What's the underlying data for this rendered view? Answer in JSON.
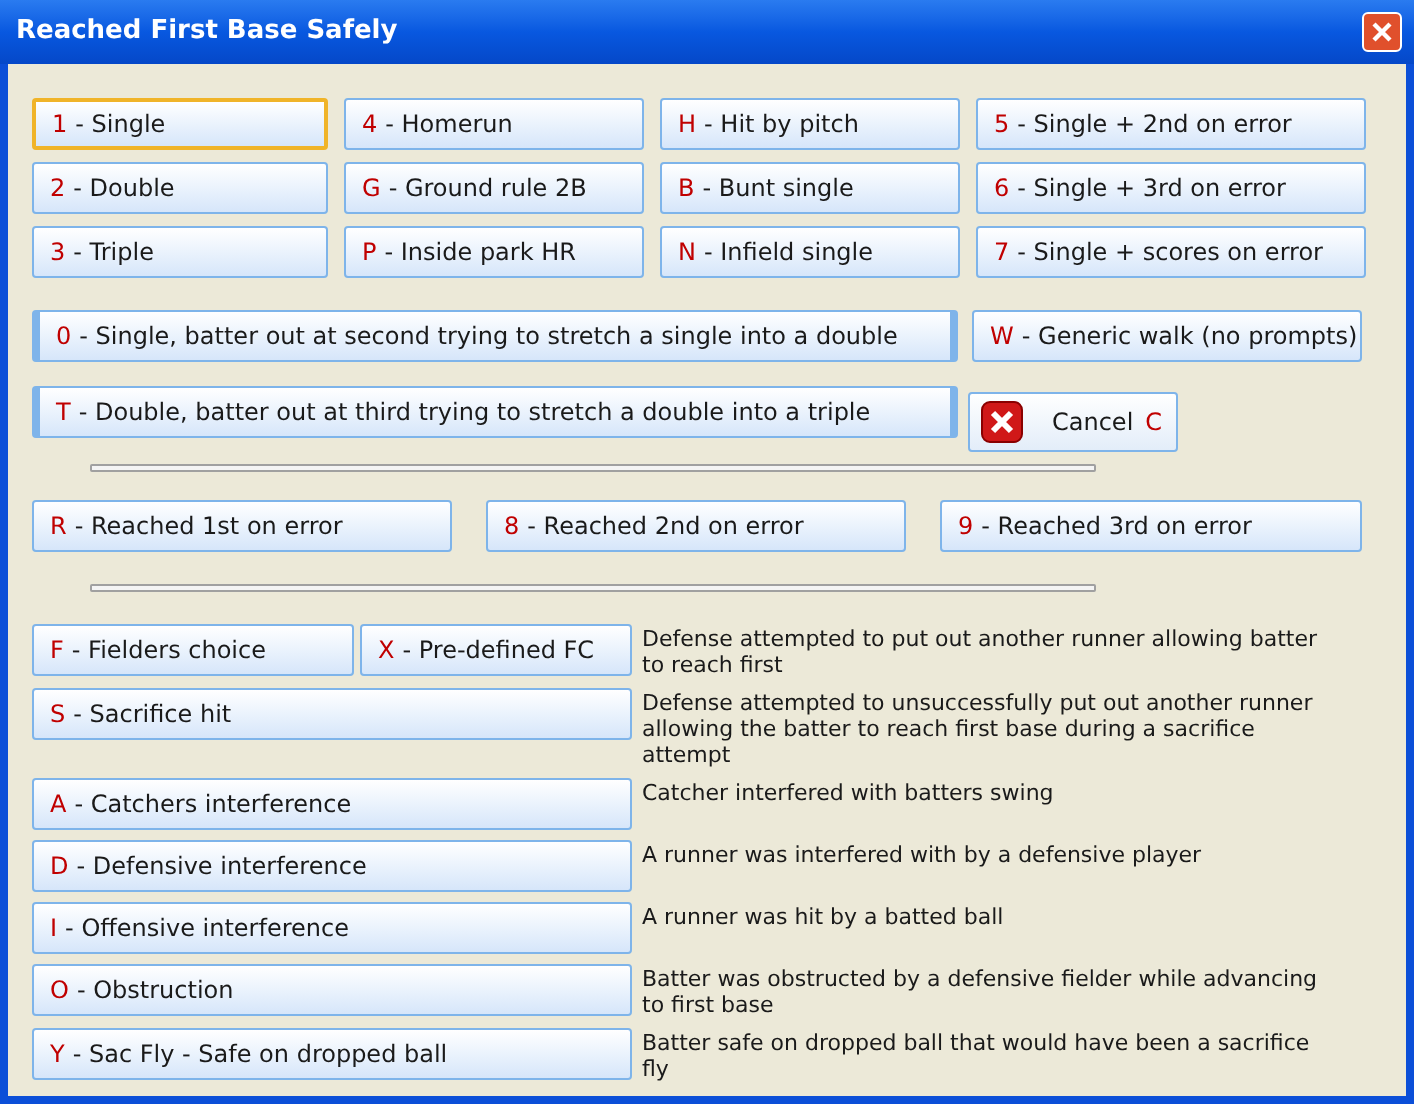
{
  "window": {
    "title": "Reached First Base Safely"
  },
  "grid": [
    {
      "key": "1",
      "label": "- Single",
      "focused": true
    },
    {
      "key": "4",
      "label": "- Homerun",
      "focused": false
    },
    {
      "key": "H",
      "label": "- Hit by pitch",
      "focused": false
    },
    {
      "key": "5",
      "label": "- Single + 2nd on error",
      "focused": false
    },
    {
      "key": "2",
      "label": "- Double",
      "focused": false
    },
    {
      "key": "G",
      "label": "- Ground rule 2B",
      "focused": false
    },
    {
      "key": "B",
      "label": "- Bunt single",
      "focused": false
    },
    {
      "key": "6",
      "label": "- Single + 3rd on error",
      "focused": false
    },
    {
      "key": "3",
      "label": "- Triple",
      "focused": false
    },
    {
      "key": "P",
      "label": "- Inside park HR",
      "focused": false
    },
    {
      "key": "N",
      "label": "- Infield single",
      "focused": false
    },
    {
      "key": "7",
      "label": "- Single + scores on error",
      "focused": false
    }
  ],
  "stretch_single": {
    "key": "0",
    "label": "- Single, batter out at second trying to stretch a single into a double"
  },
  "walk": {
    "key": "W",
    "label": "- Generic walk (no prompts)"
  },
  "stretch_double": {
    "key": "T",
    "label": "- Double, batter out at third trying to stretch a double into a triple"
  },
  "cancel": {
    "label": "Cancel",
    "key": "C"
  },
  "error_buttons": [
    {
      "key": "R",
      "label": "- Reached 1st on error"
    },
    {
      "key": "8",
      "label": "- Reached 2nd on error"
    },
    {
      "key": "9",
      "label": "- Reached 3rd on error"
    }
  ],
  "situations": [
    {
      "buttons": [
        {
          "key": "F",
          "label": "- Fielders choice"
        },
        {
          "key": "X",
          "label": "- Pre-defined FC"
        }
      ],
      "description": "Defense attempted to put out another runner allowing batter to reach first"
    },
    {
      "buttons": [
        {
          "key": "S",
          "label": "- Sacrifice hit"
        }
      ],
      "description": "Defense attempted to unsuccessfully  put out another runner allowing the batter to reach first base during a sacrifice attempt"
    },
    {
      "buttons": [
        {
          "key": "A",
          "label": "- Catchers interference"
        }
      ],
      "description": "Catcher interfered with batters swing"
    },
    {
      "buttons": [
        {
          "key": "D",
          "label": "- Defensive interference"
        }
      ],
      "description": "A runner was interfered with by a defensive player"
    },
    {
      "buttons": [
        {
          "key": "I",
          "label": "- Offensive interference"
        }
      ],
      "description": "A runner was hit by a batted ball"
    },
    {
      "buttons": [
        {
          "key": "O",
          "label": "- Obstruction"
        }
      ],
      "description": "Batter was obstructed by a defensive fielder while advancing to first base"
    },
    {
      "buttons": [
        {
          "key": "Y",
          "label": "- Sac Fly - Safe on dropped ball"
        }
      ],
      "description": "Batter safe on dropped ball that would have been a sacrifice fly"
    }
  ]
}
